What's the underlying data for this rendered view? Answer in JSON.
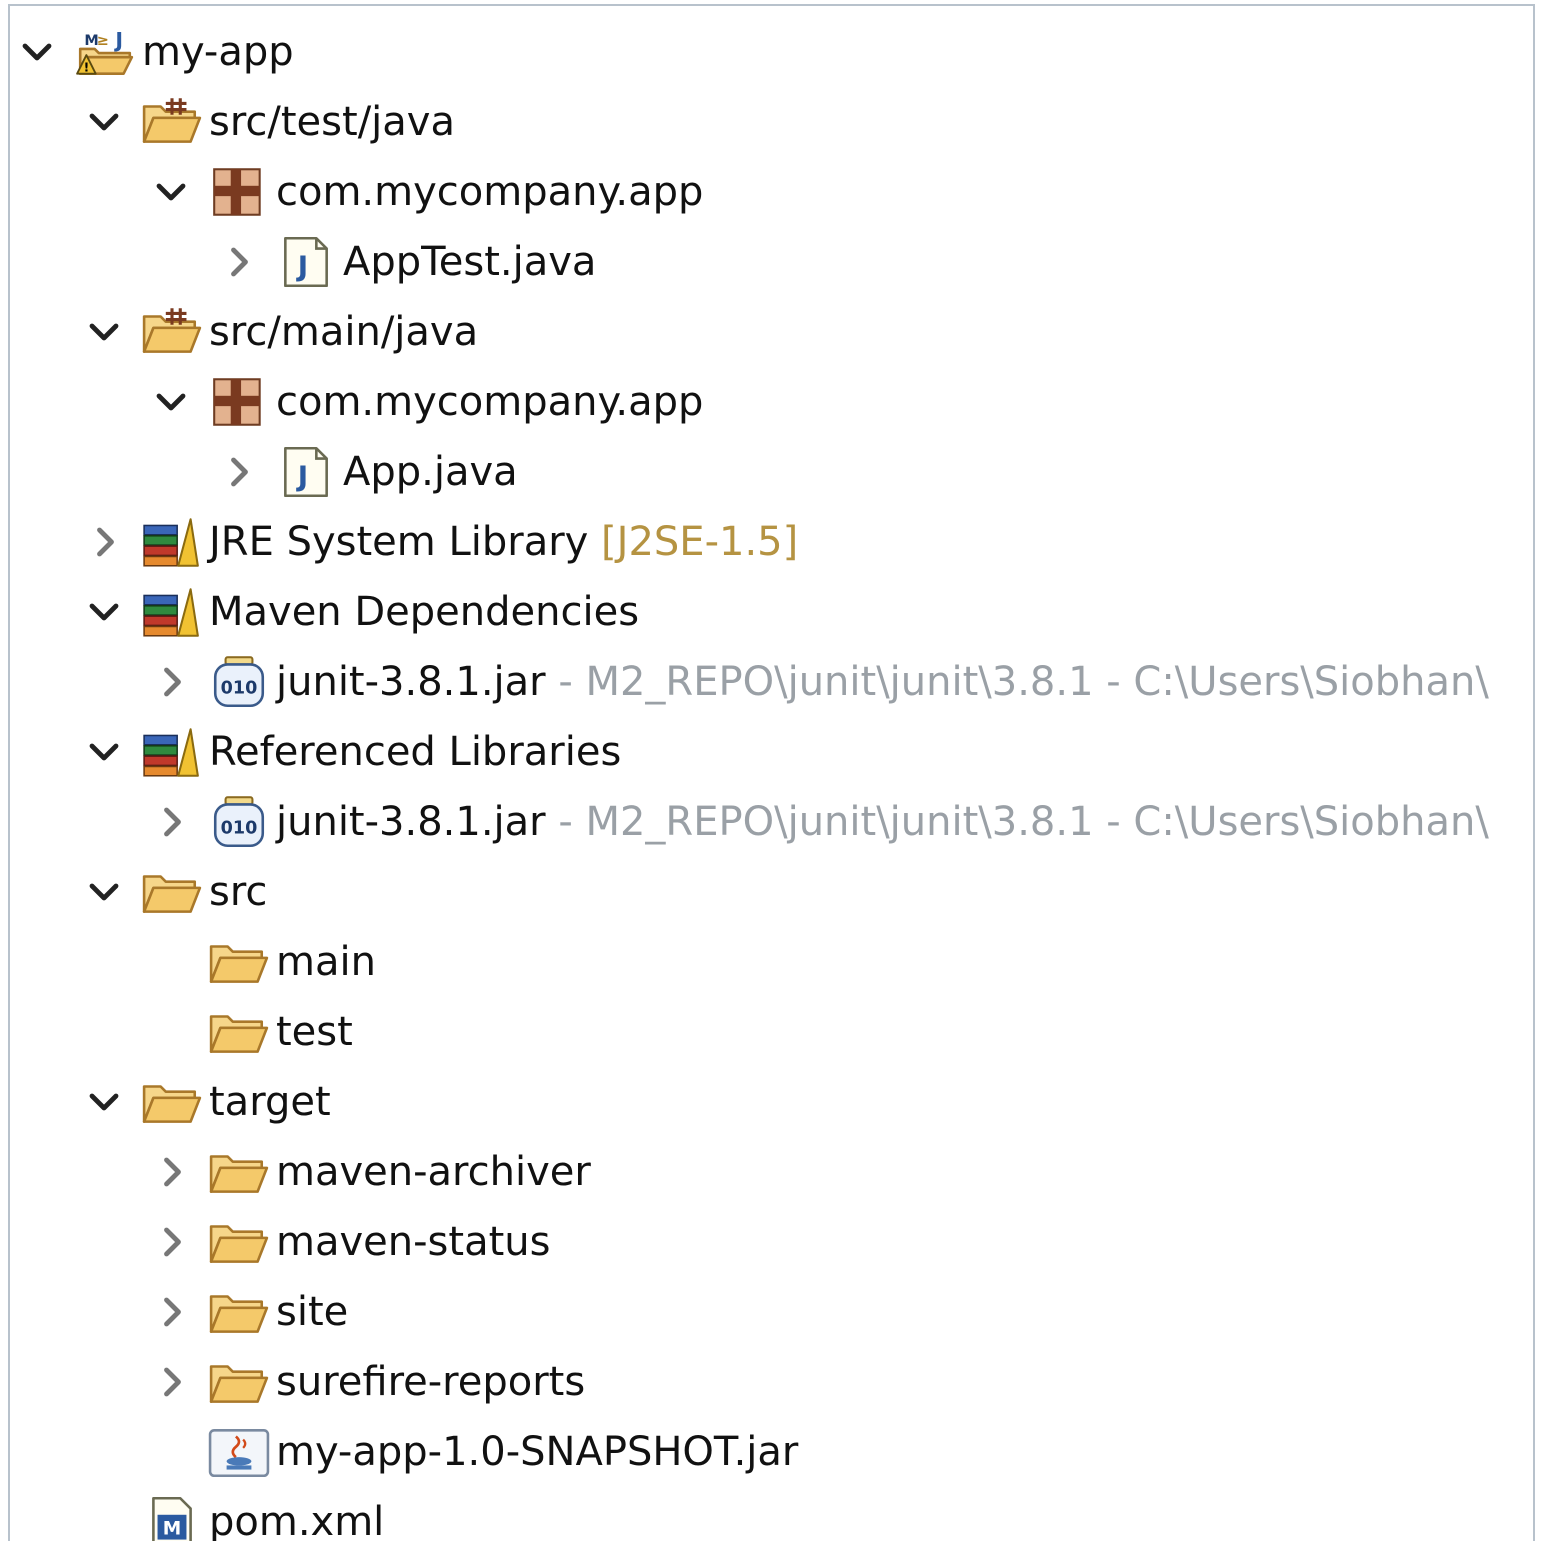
{
  "colors": {
    "decoration": "#9aa0a6",
    "tag": "#b59342",
    "folder": "#e8b84a",
    "java_blue": "#2b5aa0"
  },
  "tree": {
    "items": [
      {
        "label": "my-app",
        "icon": "maven-project-icon",
        "depth": 0,
        "state": "expanded"
      },
      {
        "label": "src/test/java",
        "icon": "source-folder-icon",
        "depth": 1,
        "state": "expanded"
      },
      {
        "label": "com.mycompany.app",
        "icon": "package-icon",
        "depth": 2,
        "state": "expanded"
      },
      {
        "label": "AppTest.java",
        "icon": "java-file-icon",
        "depth": 3,
        "state": "collapsed"
      },
      {
        "label": "src/main/java",
        "icon": "source-folder-icon",
        "depth": 1,
        "state": "expanded"
      },
      {
        "label": "com.mycompany.app",
        "icon": "package-icon",
        "depth": 2,
        "state": "expanded"
      },
      {
        "label": "App.java",
        "icon": "java-file-icon",
        "depth": 3,
        "state": "collapsed"
      },
      {
        "label": "JRE System Library",
        "tag": "[J2SE-1.5]",
        "icon": "library-icon",
        "depth": 1,
        "state": "collapsed"
      },
      {
        "label": "Maven Dependencies",
        "icon": "library-icon",
        "depth": 1,
        "state": "expanded"
      },
      {
        "label": "junit-3.8.1.jar",
        "decoration": " - M2_REPO\\junit\\junit\\3.8.1 - C:\\Users\\Siobhan\\",
        "icon": "jar-binary-icon",
        "depth": 2,
        "state": "collapsed"
      },
      {
        "label": "Referenced Libraries",
        "icon": "library-icon",
        "depth": 1,
        "state": "expanded"
      },
      {
        "label": "junit-3.8.1.jar",
        "decoration": " - M2_REPO\\junit\\junit\\3.8.1 - C:\\Users\\Siobhan\\",
        "icon": "jar-binary-icon",
        "depth": 2,
        "state": "collapsed"
      },
      {
        "label": "src",
        "icon": "folder-icon",
        "depth": 1,
        "state": "expanded"
      },
      {
        "label": "main",
        "icon": "folder-icon",
        "depth": 2,
        "state": "leaf"
      },
      {
        "label": "test",
        "icon": "folder-icon",
        "depth": 2,
        "state": "leaf"
      },
      {
        "label": "target",
        "icon": "folder-icon",
        "depth": 1,
        "state": "expanded"
      },
      {
        "label": "maven-archiver",
        "icon": "folder-icon",
        "depth": 2,
        "state": "collapsed"
      },
      {
        "label": "maven-status",
        "icon": "folder-icon",
        "depth": 2,
        "state": "collapsed"
      },
      {
        "label": "site",
        "icon": "folder-icon",
        "depth": 2,
        "state": "collapsed"
      },
      {
        "label": "surefire-reports",
        "icon": "folder-icon",
        "depth": 2,
        "state": "collapsed"
      },
      {
        "label": "my-app-1.0-SNAPSHOT.jar",
        "icon": "java-jar-icon",
        "depth": 2,
        "state": "leaf"
      },
      {
        "label": "pom.xml",
        "icon": "maven-pom-icon",
        "depth": 1,
        "state": "leaf"
      }
    ]
  }
}
